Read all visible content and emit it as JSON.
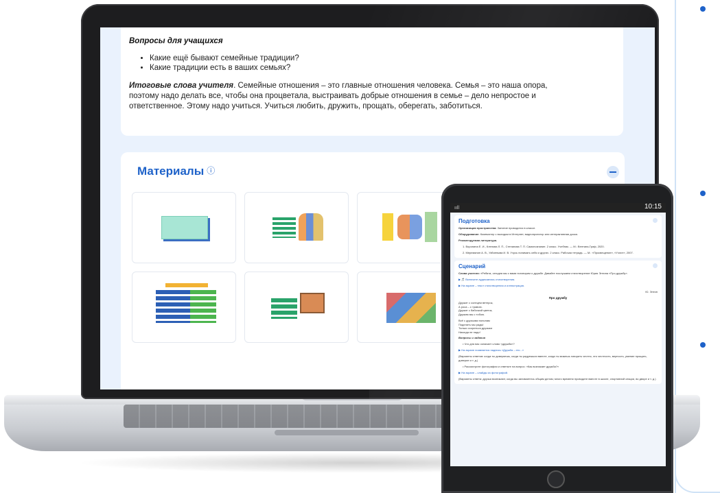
{
  "laptop": {
    "questions": {
      "heading": "Вопросы для учащихся",
      "items": [
        "Какие ещё бывают семейные традиции?",
        "Какие традиции есть в ваших семьях?"
      ],
      "summary_label": "Итоговые слова учителя",
      "summary_lines": [
        ". Семейные отношения – это главные отношения человека. Семья – это наша опора,",
        "поэтому надо делать все, чтобы она процветала, выстраивать добрые отношения в семье – дело непростое и",
        "ответственное. Этому надо учиться. Учиться любить, дружить, прощать, оберегать, заботиться."
      ]
    },
    "materials": {
      "title": "Материалы",
      "info_icon": "ⓘ",
      "thumbnails": 6
    }
  },
  "tablet": {
    "status": {
      "signal": "ııll",
      "time": "10:15"
    },
    "prep": {
      "title": "Подготовка",
      "space_label": "Организация пространства:",
      "space_text": " Занятие проводится в классе.",
      "equip_label": "Оборудование:",
      "equip_text": " Компьютер с выходом в Интернет, видеопроектор или интерактивная доска.",
      "lit_label": "Рекомендуемая литература.",
      "lit_items": [
        "1. Воронина Е. И., Клепова Л. П., Степанова Т. П. Самопознание. 2 класс. Учебник. — М.: Вентана-Граф, 2020.",
        "2. Меремянин А. В., Узбиеныва И. В. Учусь понимать себя и других. 2 класс. Рабочая тетрадь. — М.: «Просвещение», «Учлит», 2007."
      ]
    },
    "scenario": {
      "title": "Сценарий",
      "teacher_label": "Слова учителя:",
      "teacher_text": " «Ребята, сегодня мы с вами поговорим о дружбе. Давайте послушаем стихотворение Юрия Энтина «Про дружбу».",
      "link1": "▶ 🎵 Включите аудиозапись стихотворения.",
      "link2": "▶ На экране – текст стихотворения и иллюстрация.",
      "author": "Ю. Энтин",
      "poem_title": "Про дружбу",
      "poem_lines": [
        "Дружит с солнцем ветерок,",
        "А роса – с травою.",
        "Дружит с бабочкой цветок,",
        "Дружим мы с тобою.",
        "",
        "Всё с друзьями пополам",
        "Поделить мы рады!",
        "Только ссориться друзьям",
        "Никогда не надо!"
      ],
      "qa_label": "Вопросы и задания",
      "qa_item1": "• Что для вас означает слово «дружба»?",
      "link3": "▶ На экране появляется надпись «Дружба – это...»",
      "answer1": "(Варианты ответов: когда ты доверяешь, когда ты радуешься вместе, когда ты можешь говорить честно, это честность, верность, умение прощать, доверие и т. д.)",
      "qa_item2": "• Рассмотрите фотографии и ответьте на вопрос: «Как возникает дружба?»",
      "link4": "▶ На экране – слайды из фотографий.",
      "answer2": "(Варианты ответа: друзья возникают, когда вы занимаетесь общим делом; много времени проводите вместе в школе, спортивной секции, во дворе и т. д.)"
    }
  }
}
